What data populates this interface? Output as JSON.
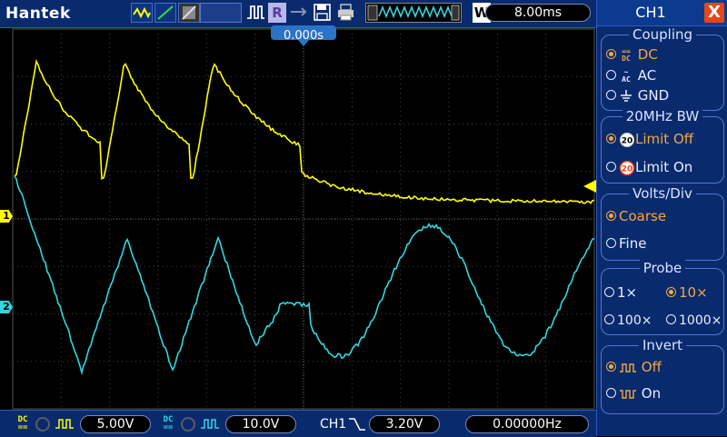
{
  "brand": "Hantek",
  "top_toolbar": {
    "run_mode_r": "R",
    "run_mode_w": "W",
    "timebase": "8.00ms",
    "trigger_position": "0.000s"
  },
  "channels": {
    "ch1_marker": "1",
    "ch2_marker": "2",
    "ch1_color": "#ffff00",
    "ch2_color": "#33d6e0"
  },
  "bottom_bar": {
    "ch1_volts": "5.00V",
    "ch2_volts": "10.0V",
    "trigger_source": "CH1",
    "trigger_level": "3.20V",
    "frequency": "0.00000Hz"
  },
  "panel": {
    "title": "CH1",
    "close": "X",
    "coupling": {
      "title": "Coupling",
      "options": [
        {
          "label": "DC",
          "selected": true
        },
        {
          "label": "AC",
          "selected": false
        },
        {
          "label": "GND",
          "selected": false
        }
      ]
    },
    "bandwidth": {
      "title": "20MHz BW",
      "options": [
        {
          "label": "Limit Off",
          "selected": true
        },
        {
          "label": "Limit On",
          "selected": false
        }
      ]
    },
    "volts_div": {
      "title": "Volts/Div",
      "options": [
        {
          "label": "Coarse",
          "selected": true
        },
        {
          "label": "Fine",
          "selected": false
        }
      ]
    },
    "probe": {
      "title": "Probe",
      "options": [
        {
          "label": "1×",
          "selected": false
        },
        {
          "label": "10×",
          "selected": true
        },
        {
          "label": "100×",
          "selected": false
        },
        {
          "label": "1000×",
          "selected": false
        }
      ]
    },
    "invert": {
      "title": "Invert",
      "options": [
        {
          "label": "Off",
          "selected": true
        },
        {
          "label": "On",
          "selected": false
        }
      ]
    }
  },
  "colors": {
    "panel_bg": "#0a2a6e",
    "selected": "#f5a83a",
    "close": "#e8451a"
  }
}
